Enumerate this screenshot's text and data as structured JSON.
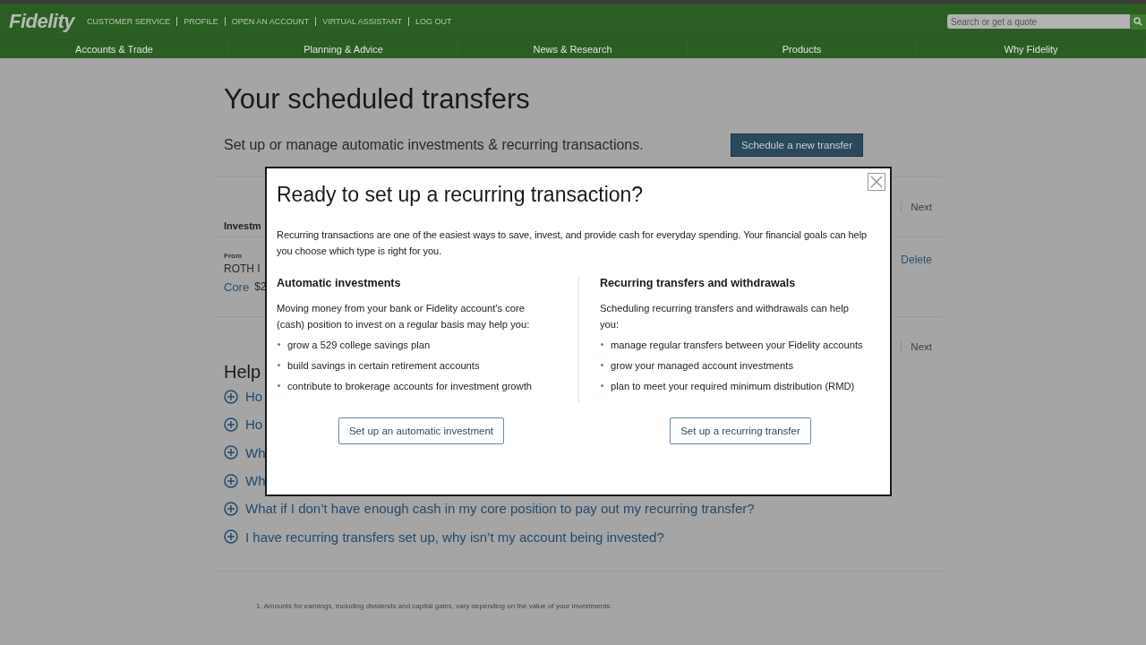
{
  "header": {
    "logo": "Fidelity",
    "utility_links": [
      "CUSTOMER SERVICE",
      "PROFILE",
      "OPEN AN ACCOUNT",
      "VIRTUAL ASSISTANT",
      "LOG OUT"
    ],
    "search": {
      "placeholder": "Search or get a quote"
    }
  },
  "nav": [
    {
      "label": "Accounts & Trade"
    },
    {
      "label": "Planning & Advice"
    },
    {
      "label": "News & Research"
    },
    {
      "label": "Products"
    },
    {
      "label": "Why Fidelity"
    }
  ],
  "page": {
    "title": "Your scheduled transfers",
    "subtitle": "Set up or manage automatic investments & recurring transactions.",
    "schedule_button": "Schedule a new transfer",
    "pager_top": "Next",
    "column_header": "Investm",
    "row": {
      "from_label": "From",
      "account": "ROTH I",
      "core_label": "Core",
      "amount": "$2",
      "delete": "Delete"
    },
    "pager_bottom": "Next",
    "help_title": "Help",
    "faq": [
      {
        "question": "Ho"
      },
      {
        "question": "Ho"
      },
      {
        "question": "Wh"
      },
      {
        "question": "Wh"
      },
      {
        "question": "What if I don’t have enough cash in my core position to pay out my recurring transfer?"
      },
      {
        "question": "I have recurring transfers set up, why isn’t my account being invested?"
      }
    ],
    "footnote": "1. Amounts for earnings, including dividends and capital gains, vary depending on the value of your investments."
  },
  "modal": {
    "title": "Ready to set up a recurring transaction?",
    "intro": "Recurring transactions are one of the easiest ways to save, invest, and provide cash for everyday spending. Your financial goals can help you choose which type is right for you.",
    "columns": [
      {
        "heading": "Automatic investments",
        "text": "Moving money from your bank or Fidelity account's core (cash) position to invest on a regular basis may help you:",
        "bullets": [
          "grow a 529 college savings plan",
          "build savings in certain retirement accounts",
          "contribute to brokerage accounts for investment growth"
        ],
        "button": "Set up an automatic investment"
      },
      {
        "heading": "Recurring transfers and withdrawals",
        "text": "Scheduling recurring transfers and withdrawals can help you:",
        "bullets": [
          "manage regular transfers between your Fidelity accounts",
          "grow your managed account investments",
          "plan to meet your required minimum distribution (RMD)"
        ],
        "button": "Set up a recurring transfer"
      }
    ]
  }
}
